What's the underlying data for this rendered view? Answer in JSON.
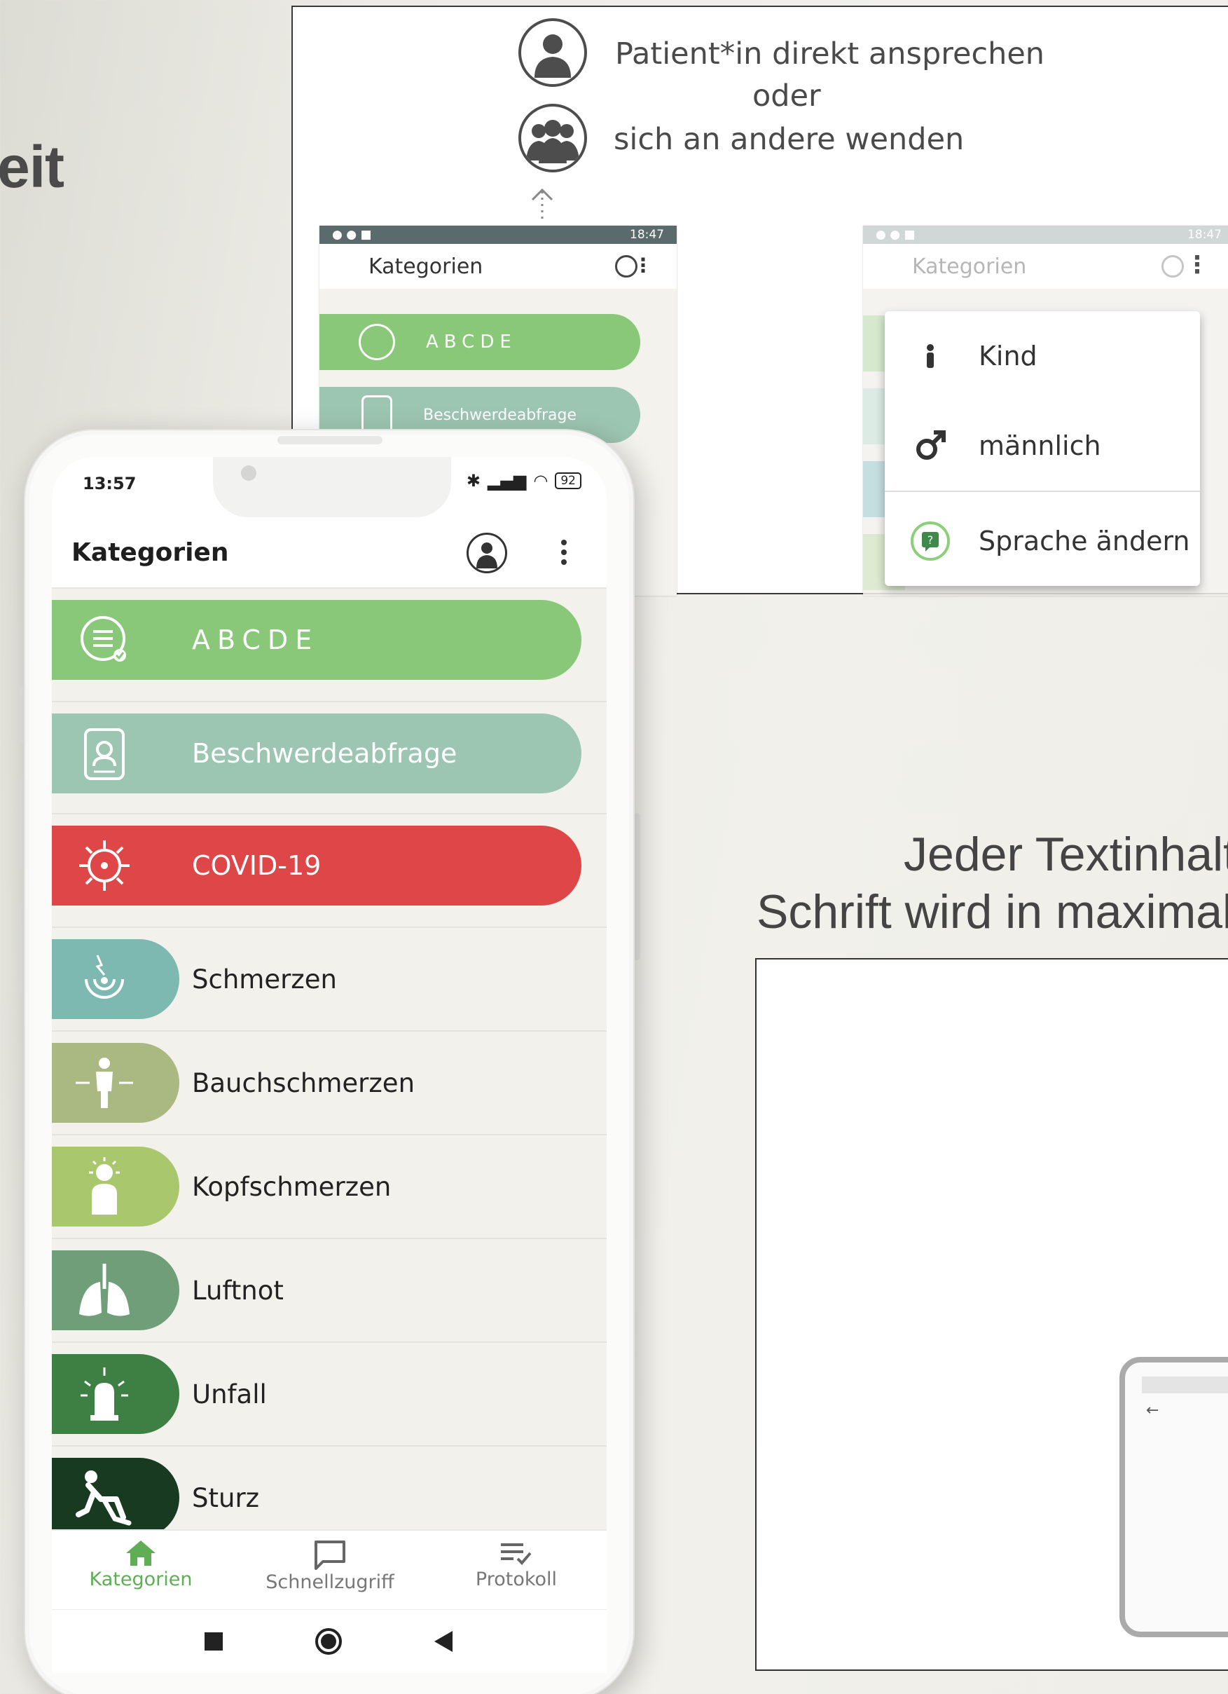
{
  "slide": {
    "heading_partial": "eit",
    "text_line1": "Jeder Textinhalt",
    "text_line2": "Schrift wird in maximal"
  },
  "figure_top": {
    "hint_line1": "Patient*in direkt ansprechen",
    "hint_line2": "oder",
    "hint_line3": "sich an andere wenden",
    "mini_left": {
      "time": "18:47",
      "title": "Kategorien",
      "items": [
        "ABCDE",
        "Beschwerdeabfrage"
      ]
    },
    "mini_right": {
      "time": "18:47",
      "title": "Kategorien"
    },
    "menu_items": [
      {
        "label": "Kind",
        "icon": "child-icon"
      },
      {
        "label": "männlich",
        "icon": "male-symbol-icon"
      },
      {
        "label": "Sprache ändern",
        "icon": "language-icon"
      }
    ]
  },
  "phone": {
    "status": {
      "time": "13:57",
      "battery": "92"
    },
    "appbar": {
      "title": "Kategorien"
    },
    "categories": [
      {
        "label": "ABCDE",
        "color": "#88c878",
        "icon": "list-check-icon"
      },
      {
        "label": "Beschwerdeabfrage",
        "color": "#9dc6b2",
        "icon": "clipboard-person-icon"
      },
      {
        "label": "COVID-19",
        "color": "#de4648",
        "icon": "virus-icon"
      },
      {
        "label": "Schmerzen",
        "color": "#7db8b1",
        "icon": "pain-target-icon"
      },
      {
        "label": "Bauchschmerzen",
        "color": "#aab882",
        "icon": "abdominal-pain-icon"
      },
      {
        "label": "Kopfschmerzen",
        "color": "#a9c86e",
        "icon": "headache-icon"
      },
      {
        "label": "Luftnot",
        "color": "#6f9e78",
        "icon": "lungs-icon"
      },
      {
        "label": "Unfall",
        "color": "#3e7f44",
        "icon": "siren-icon"
      },
      {
        "label": "Sturz",
        "color": "#173a20",
        "icon": "fall-icon"
      }
    ],
    "bottom_nav": [
      {
        "label": "Kategorien",
        "icon": "home-icon",
        "active": true
      },
      {
        "label": "Schnellzugriff",
        "icon": "chat-bubble-icon",
        "active": false
      },
      {
        "label": "Protokoll",
        "icon": "list-check-icon",
        "active": false
      }
    ]
  }
}
